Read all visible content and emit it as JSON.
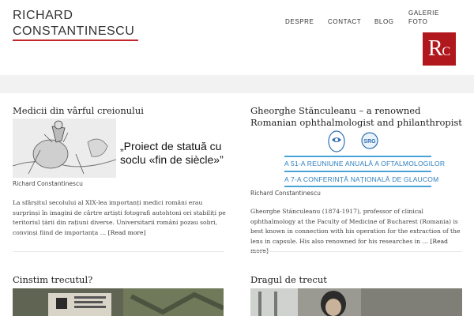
{
  "site": {
    "title": "RICHARD CONSTANTINESCU",
    "logo_r": "R",
    "logo_c": "C"
  },
  "nav": {
    "items": [
      "DESPRE",
      "CONTACT",
      "BLOG",
      "GALERIE FOTO"
    ]
  },
  "posts": [
    {
      "title": "Medicii din vârful creionului",
      "image_text": "„Proiect de statuă cu soclu «fin de siècle»”",
      "caption": "Richard Constantinescu",
      "excerpt": "La sfârșitul secolului al XIX-lea importanți medici români erau surprinși în imagini de cârtre artiști fotografi autohtoni ori stabiliți pe teritoriul țării din rațiuni diverse. Universitarii români pozau sobri, convinși fiind de importanța …",
      "more": "[Read more]"
    },
    {
      "title": "Gheorghe Stănculeanu – a renowned Romanian ophthalmologist and philanthropist",
      "image_line1": "A 51-A REUNIUNE ANUALĂ A OFTALMOLOGILOR",
      "image_line2": "A 7-A CONFERINȚĂ NAȚIONALĂ DE GLAUCOM",
      "caption": "Richard Constantinescu",
      "excerpt": "Gheorghe Stănculeanu (1874-1917), professor of clinical ophthalmology at the Faculty of Medicine of Bucharest (Romania) is best known in connection with his operation for the extraction of the lens in capsule. His also renowned for his researches in …",
      "more": "[Read more]"
    },
    {
      "title": "Cinstim trecutul?"
    },
    {
      "title": "Dragul de trecut"
    }
  ],
  "colors": {
    "accent": "#c1272d",
    "logo_bg": "#b1181d",
    "link_blue": "#2f7fbf"
  }
}
